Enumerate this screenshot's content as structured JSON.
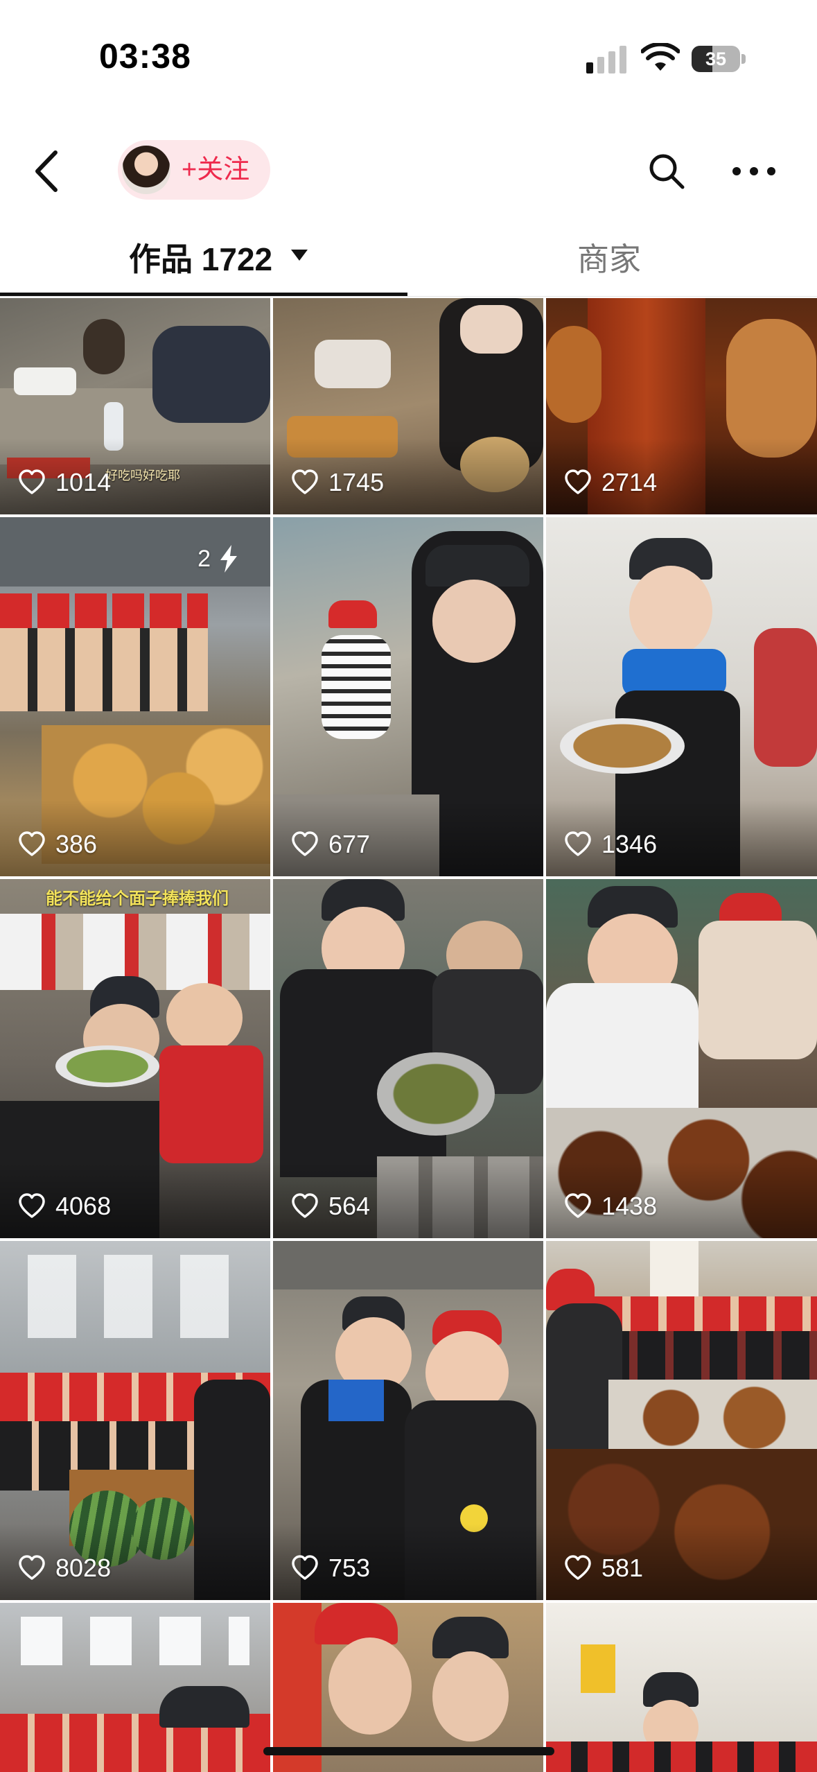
{
  "status_bar": {
    "time": "03:38",
    "battery": "35"
  },
  "header": {
    "follow_label": "+关注"
  },
  "tabs": {
    "works_label": "作品 1722",
    "merchant_label": "商家"
  },
  "grid": {
    "tiles": [
      {
        "likes": "1014",
        "caption": "好吃吗好吃耶"
      },
      {
        "likes": "1745"
      },
      {
        "likes": "2714"
      },
      {
        "likes": "386",
        "badge": "2"
      },
      {
        "likes": "677"
      },
      {
        "likes": "1346"
      },
      {
        "likes": "4068",
        "caption": "能不能给个面子捧捧我们"
      },
      {
        "likes": "564"
      },
      {
        "likes": "1438"
      },
      {
        "likes": "8028"
      },
      {
        "likes": "753"
      },
      {
        "likes": "581"
      },
      {},
      {},
      {}
    ]
  },
  "colors": {
    "accent": "#ee2a4d",
    "pill_bg": "#fde7ea"
  }
}
